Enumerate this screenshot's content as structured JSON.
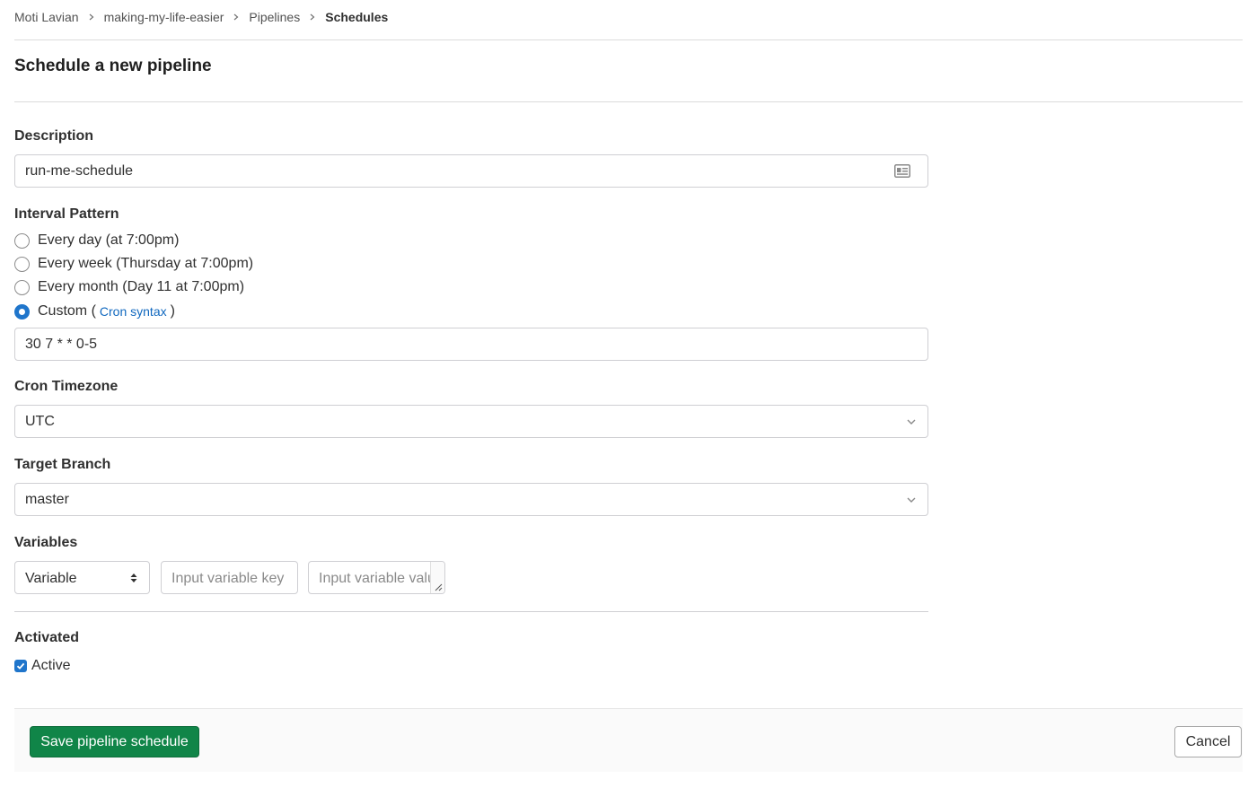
{
  "breadcrumb": {
    "items": [
      "Moti Lavian",
      "making-my-life-easier",
      "Pipelines",
      "Schedules"
    ]
  },
  "page_title": "Schedule a new pipeline",
  "description": {
    "label": "Description",
    "value": "run-me-schedule",
    "icon": "id-card-icon"
  },
  "interval": {
    "label": "Interval Pattern",
    "options": [
      {
        "label": "Every day (at 7:00pm)",
        "checked": false
      },
      {
        "label": "Every week (Thursday at 7:00pm)",
        "checked": false
      },
      {
        "label": "Every month (Day 11 at 7:00pm)",
        "checked": false
      },
      {
        "label": "Custom (",
        "checked": true
      }
    ],
    "cron_link": "Cron syntax",
    "custom_suffix": ")",
    "custom_value": "30 7 * * 0-5"
  },
  "timezone": {
    "label": "Cron Timezone",
    "value": "UTC"
  },
  "branch": {
    "label": "Target Branch",
    "value": "master"
  },
  "variables": {
    "label": "Variables",
    "type_value": "Variable",
    "key_placeholder": "Input variable key",
    "value_placeholder": "Input variable value"
  },
  "activated": {
    "label": "Activated",
    "checkbox_label": "Active",
    "checked": true
  },
  "footer": {
    "save_label": "Save pipeline schedule",
    "cancel_label": "Cancel"
  },
  "colors": {
    "primary_green": "#108548",
    "link_blue": "#1068bf",
    "radio_blue": "#1f75cb"
  }
}
